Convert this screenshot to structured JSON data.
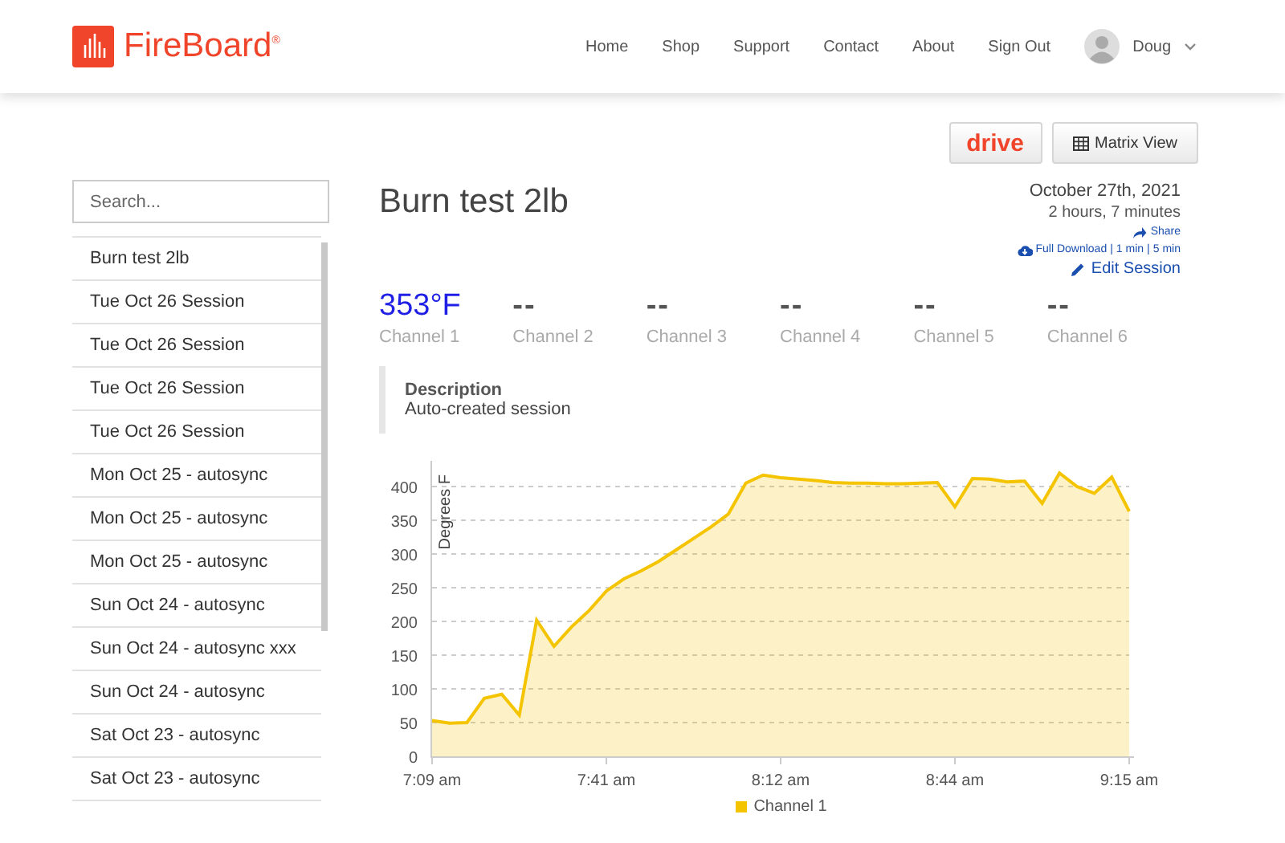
{
  "header": {
    "logo": "FireBoard$^{®}$",
    "nav": [
      {
        "label": "Home"
      },
      {
        "label": "Shop"
      },
      {
        "label": "Support"
      },
      {
        "label": "Contact"
      },
      {
        "label": "About"
      },
      {
        "label": "Sign Out"
      }
    ],
    "user": {
      "name": "Doug"
    }
  },
  "toolbar": {
    "buttons": [
      {
        "kind": "drive",
        "label": "drive"
      },
      {
        "kind": "matrix",
        "label": "Matrix View"
      }
    ]
  },
  "sidebar": {
    "search": {
      "placeholder": "Search..."
    },
    "items": [
      {
        "label": "Burn test 2lb"
      },
      {
        "label": "Tue Oct 26 Session"
      },
      {
        "label": "Tue Oct 26 Session"
      },
      {
        "label": "Tue Oct 26 Session"
      },
      {
        "label": "Tue Oct 26 Session"
      },
      {
        "label": "Mon Oct 25 - autosync"
      },
      {
        "label": "Mon Oct 25 - autosync"
      },
      {
        "label": "Mon Oct 25 - autosync"
      },
      {
        "label": "Sun Oct 24 - autosync"
      },
      {
        "label": "Sun Oct 24 - autosync xxx"
      },
      {
        "label": "Sun Oct 24 - autosync"
      },
      {
        "label": "Sat Oct 23 - autosync"
      },
      {
        "label": "Sat Oct 23 - autosync"
      }
    ]
  },
  "session": {
    "title": "Burn test 2lb",
    "date": "October 27th, 2021",
    "duration": "2 hours, 7 minutes",
    "share": "Share",
    "downloads": [
      "Full Download",
      "1 min",
      "5 min"
    ],
    "separator": "|",
    "edit": "Edit Session",
    "channels": [
      {
        "reading": "353°F",
        "name": "Channel 1"
      },
      {
        "reading": "--",
        "name": "Channel 2"
      },
      {
        "reading": "--",
        "name": "Channel 3"
      },
      {
        "reading": "--",
        "name": "Channel 4"
      },
      {
        "reading": "--",
        "name": "Channel 5"
      },
      {
        "reading": "--",
        "name": "Channel 6"
      }
    ],
    "description": {
      "heading": "Description",
      "text": "Auto-created session"
    },
    "chart_data": {
      "type": "area",
      "ylabel": "Degrees F",
      "grid": true,
      "categories": [
        "7:09 am",
        null,
        null,
        null,
        null,
        null,
        null,
        null,
        null,
        null,
        "7:41 am",
        null,
        null,
        null,
        null,
        null,
        null,
        null,
        null,
        null,
        "8:12 am",
        null,
        null,
        null,
        null,
        null,
        null,
        null,
        null,
        null,
        "8:44 am",
        null,
        null,
        null,
        null,
        null,
        null,
        null,
        null,
        null,
        "9:15 am"
      ],
      "series": [
        {
          "name": "Channel 1",
          "color": "#f5c400",
          "values": [
            53,
            49,
            50,
            86,
            92,
            61,
            202,
            163,
            192,
            216,
            245,
            263,
            275,
            289,
            306,
            323,
            340,
            359,
            405,
            417,
            413,
            411,
            409,
            406,
            405,
            405,
            404,
            404,
            405,
            406,
            370,
            412,
            411,
            407,
            408,
            375,
            420,
            400,
            390,
            414,
            363
          ]
        }
      ],
      "ylim": [
        0,
        440
      ],
      "yticks": [
        0,
        50,
        100,
        150,
        200,
        250,
        300,
        350,
        400
      ]
    }
  }
}
